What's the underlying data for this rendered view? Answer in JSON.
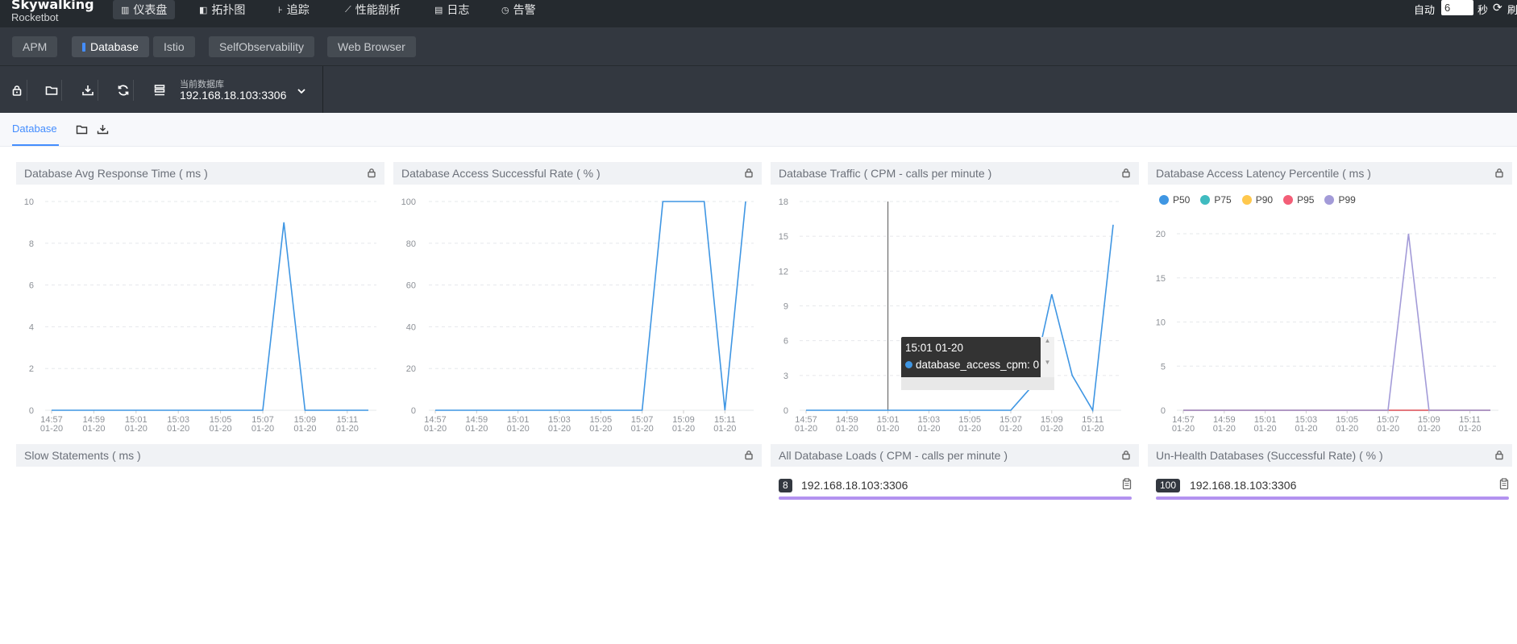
{
  "app": {
    "brand": "Skywalking",
    "brand_sub": "Rocketbot"
  },
  "nav": [
    {
      "label": "仪表盘",
      "icon": "dashboard-icon",
      "active": true
    },
    {
      "label": "拓扑图",
      "icon": "topology-icon"
    },
    {
      "label": "追踪",
      "icon": "trace-icon"
    },
    {
      "label": "性能剖析",
      "icon": "profile-icon"
    },
    {
      "label": "日志",
      "icon": "log-icon"
    },
    {
      "label": "告警",
      "icon": "alarm-icon"
    }
  ],
  "auto_refresh": {
    "label": "自动",
    "value": "6",
    "unit": "秒",
    "refresh_label": "刷"
  },
  "service_tabs": [
    "APM",
    "Database",
    "Istio",
    "SelfObservability",
    "Web Browser"
  ],
  "active_service_tab": "Database",
  "toolbar": {
    "db_label": "当前数据库",
    "db_value": "192.168.18.103:3306"
  },
  "dashboard_tab": "Database",
  "panels": {
    "avg_response": "Database Avg Response Time ( ms )",
    "success_rate": "Database Access Successful Rate ( % )",
    "traffic": "Database Traffic ( CPM - calls per minute )",
    "latency_percentile": "Database Access Latency Percentile ( ms )",
    "slow_statements": "Slow Statements ( ms )",
    "all_loads": "All Database Loads ( CPM - calls per minute )",
    "unhealth": "Un-Health Databases (Successful Rate) ( % )"
  },
  "time_axis": [
    "14:57",
    "14:59",
    "15:01",
    "15:03",
    "15:05",
    "15:07",
    "15:09",
    "15:11"
  ],
  "time_axis_date": "01-20",
  "tooltip": {
    "time": "15:01 01-20",
    "series": "database_access_cpm",
    "value": "0"
  },
  "legend": [
    {
      "name": "P50",
      "color": "#3f96e3"
    },
    {
      "name": "P75",
      "color": "#3fbbc0"
    },
    {
      "name": "P90",
      "color": "#ffc84d"
    },
    {
      "name": "P95",
      "color": "#f35e77"
    },
    {
      "name": "P99",
      "color": "#a39bd8"
    }
  ],
  "all_loads_list": [
    {
      "value": "8",
      "name": "192.168.18.103:3306"
    }
  ],
  "unhealth_list": [
    {
      "value": "100",
      "name": "192.168.18.103:3306"
    }
  ],
  "chart_data": [
    {
      "type": "line",
      "title": "Database Avg Response Time ( ms )",
      "x": [
        "14:57",
        "14:58",
        "14:59",
        "15:00",
        "15:01",
        "15:02",
        "15:03",
        "15:04",
        "15:05",
        "15:06",
        "15:07",
        "15:08",
        "15:09",
        "15:10",
        "15:11",
        "15:12"
      ],
      "series": [
        {
          "values": [
            0,
            0,
            0,
            0,
            0,
            0,
            0,
            0,
            0,
            0,
            0,
            9,
            0,
            0,
            0,
            0
          ]
        }
      ],
      "ylim": [
        0,
        10
      ],
      "yticks": [
        0,
        2,
        4,
        6,
        8,
        10
      ],
      "grid": true
    },
    {
      "type": "line",
      "title": "Database Access Successful Rate ( % )",
      "x": [
        "14:57",
        "14:58",
        "14:59",
        "15:00",
        "15:01",
        "15:02",
        "15:03",
        "15:04",
        "15:05",
        "15:06",
        "15:07",
        "15:08",
        "15:09",
        "15:10",
        "15:11",
        "15:12"
      ],
      "series": [
        {
          "values": [
            0,
            0,
            0,
            0,
            0,
            0,
            0,
            0,
            0,
            0,
            0,
            100,
            100,
            100,
            0,
            100
          ]
        }
      ],
      "ylim": [
        0,
        100
      ],
      "yticks": [
        0,
        20,
        40,
        60,
        80,
        100
      ],
      "grid": true
    },
    {
      "type": "line",
      "title": "Database Traffic ( CPM - calls per minute )",
      "x": [
        "14:57",
        "14:58",
        "14:59",
        "15:00",
        "15:01",
        "15:02",
        "15:03",
        "15:04",
        "15:05",
        "15:06",
        "15:07",
        "15:08",
        "15:09",
        "15:10",
        "15:11",
        "15:12"
      ],
      "series": [
        {
          "name": "database_access_cpm",
          "values": [
            0,
            0,
            0,
            0,
            0,
            0,
            0,
            0,
            0,
            0,
            0,
            2,
            10,
            3,
            0,
            16
          ]
        }
      ],
      "ylim": [
        0,
        18
      ],
      "yticks": [
        0,
        3,
        6,
        9,
        12,
        15,
        18
      ],
      "grid": true
    },
    {
      "type": "line",
      "title": "Database Access Latency Percentile ( ms )",
      "x": [
        "14:57",
        "14:58",
        "14:59",
        "15:00",
        "15:01",
        "15:02",
        "15:03",
        "15:04",
        "15:05",
        "15:06",
        "15:07",
        "15:08",
        "15:09",
        "15:10",
        "15:11",
        "15:12"
      ],
      "series": [
        {
          "name": "P50",
          "values": [
            0,
            0,
            0,
            0,
            0,
            0,
            0,
            0,
            0,
            0,
            0,
            0,
            0,
            0,
            0,
            0
          ]
        },
        {
          "name": "P75",
          "values": [
            0,
            0,
            0,
            0,
            0,
            0,
            0,
            0,
            0,
            0,
            0,
            0,
            0,
            0,
            0,
            0
          ]
        },
        {
          "name": "P90",
          "values": [
            0,
            0,
            0,
            0,
            0,
            0,
            0,
            0,
            0,
            0,
            0,
            0,
            0,
            0,
            0,
            0
          ]
        },
        {
          "name": "P95",
          "values": [
            0,
            0,
            0,
            0,
            0,
            0,
            0,
            0,
            0,
            0,
            0,
            0,
            0,
            0,
            0,
            0
          ]
        },
        {
          "name": "P99",
          "values": [
            0,
            0,
            0,
            0,
            0,
            0,
            0,
            0,
            0,
            0,
            0,
            20,
            0,
            0,
            0,
            0
          ]
        }
      ],
      "ylim": [
        0,
        20
      ],
      "yticks": [
        0,
        5,
        10,
        15,
        20
      ],
      "grid": true,
      "legend": "top-left"
    }
  ]
}
